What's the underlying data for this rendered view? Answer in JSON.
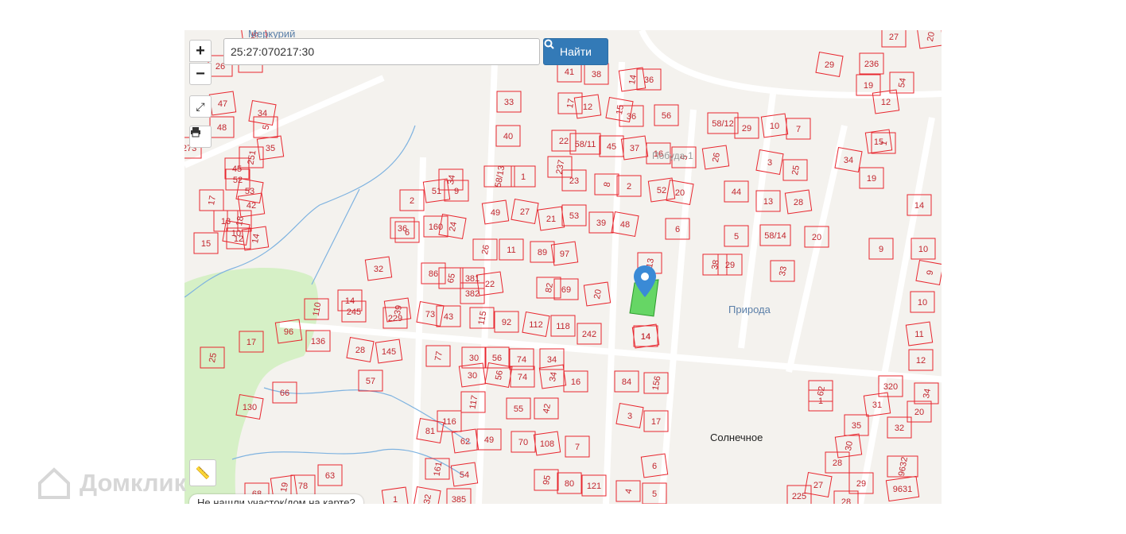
{
  "search": {
    "value": "25:27:070217:30",
    "button_label": "Найти",
    "icon": "search-icon"
  },
  "controls": {
    "zoom_in": "+",
    "zoom_out": "−",
    "fullscreen_icon": "expand-icon",
    "print_icon": "printer-icon",
    "ruler_icon": "ruler-icon"
  },
  "not_found_text": "Не нашли участок/дом на карте?",
  "watermark": "Домклик",
  "places": {
    "merkuriy": "Меркурий",
    "priroda": "Природа",
    "solnechnoe": "Солнечное",
    "pobuda": "Побуда-1"
  },
  "colors": {
    "parcel_border": "#e8262e",
    "parcel_label": "#c2262e",
    "selected_fill": "#4cd14c",
    "forest": "#d6f0c6",
    "stream": "#7fb3e0",
    "road": "#ffffff",
    "background": "#f4f2ee",
    "marker": "#3a8ad6",
    "place_label": "#5b7fa8"
  },
  "parcel_labels": [
    "25",
    "26",
    "8",
    "13",
    "251",
    "47",
    "48",
    "34",
    "5",
    "273",
    "35",
    "45",
    "17",
    "52",
    "53",
    "42",
    "18",
    "15",
    "13",
    "12",
    "14",
    "10",
    "2",
    "36",
    "34",
    "51",
    "9",
    "160",
    "24",
    "6",
    "32",
    "86",
    "65",
    "381",
    "382",
    "22",
    "115",
    "92",
    "14",
    "245",
    "39",
    "229",
    "73",
    "43",
    "110",
    "96",
    "136",
    "17",
    "25",
    "28",
    "145",
    "57",
    "77",
    "30",
    "56",
    "30",
    "56",
    "74",
    "34",
    "74",
    "34",
    "16",
    "66",
    "130",
    "117",
    "62",
    "49",
    "55",
    "42",
    "70",
    "108",
    "7",
    "95",
    "80",
    "121",
    "54",
    "161",
    "81",
    "116",
    "68",
    "19",
    "78",
    "63",
    "385",
    "32",
    "1",
    "33",
    "40",
    "58/13",
    "1",
    "49",
    "27",
    "26",
    "11",
    "89",
    "97",
    "82",
    "69",
    "112",
    "118",
    "20",
    "242",
    "41",
    "38",
    "17",
    "12",
    "22",
    "58/11",
    "237",
    "23",
    "21",
    "53",
    "15",
    "36",
    "45",
    "37",
    "8",
    "2",
    "39",
    "48",
    "14",
    "36",
    "56",
    "16",
    "5",
    "52",
    "20",
    "6",
    "13",
    "14",
    "14",
    "84",
    "156",
    "3",
    "17",
    "6",
    "4",
    "5",
    "58/12",
    "29",
    "26",
    "44",
    "5",
    "29",
    "38",
    "10",
    "7",
    "3",
    "25",
    "13",
    "28",
    "58/14",
    "33",
    "20",
    "34",
    "15",
    "1",
    "19",
    "9",
    "27",
    "20",
    "29",
    "236",
    "19",
    "54",
    "12",
    "14",
    "10",
    "9",
    "10",
    "11",
    "12",
    "62",
    "1",
    "320",
    "31",
    "34",
    "20",
    "32",
    "35",
    "30",
    "28",
    "27",
    "29",
    "9632",
    "9631",
    "225",
    "28"
  ],
  "selected_parcel": "25:27:070217:30"
}
